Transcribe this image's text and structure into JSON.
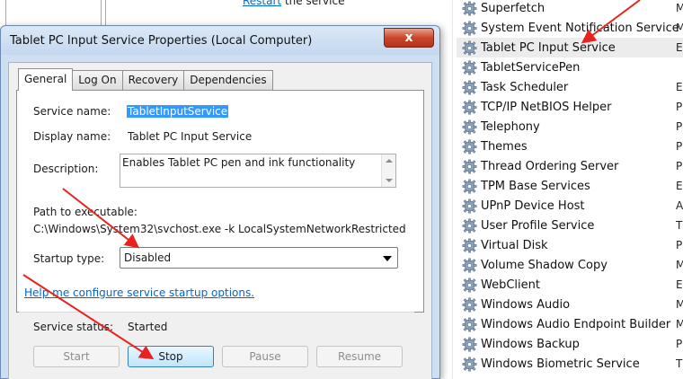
{
  "background": {
    "restart_link": "Restart",
    "restart_rest": " the service",
    "services": [
      {
        "name": "Superfetch",
        "col": "M",
        "selected": false
      },
      {
        "name": "System Event Notification Service",
        "col": "M",
        "selected": false
      },
      {
        "name": "Tablet PC Input Service",
        "col": "E",
        "selected": true
      },
      {
        "name": "TabletServicePen",
        "col": "",
        "selected": false
      },
      {
        "name": "Task Scheduler",
        "col": "E",
        "selected": false
      },
      {
        "name": "TCP/IP NetBIOS Helper",
        "col": "P",
        "selected": false
      },
      {
        "name": "Telephony",
        "col": "P",
        "selected": false
      },
      {
        "name": "Themes",
        "col": "P",
        "selected": false
      },
      {
        "name": "Thread Ordering Server",
        "col": "P",
        "selected": false
      },
      {
        "name": "TPM Base Services",
        "col": "E",
        "selected": false
      },
      {
        "name": "UPnP Device Host",
        "col": "A",
        "selected": false
      },
      {
        "name": "User Profile Service",
        "col": "T",
        "selected": false
      },
      {
        "name": "Virtual Disk",
        "col": "P",
        "selected": false
      },
      {
        "name": "Volume Shadow Copy",
        "col": "M",
        "selected": false
      },
      {
        "name": "WebClient",
        "col": "E",
        "selected": false
      },
      {
        "name": "Windows Audio",
        "col": "M",
        "selected": false
      },
      {
        "name": "Windows Audio Endpoint Builder",
        "col": "M",
        "selected": false
      },
      {
        "name": "Windows Backup",
        "col": "P",
        "selected": false
      },
      {
        "name": "Windows Biometric Service",
        "col": "T",
        "selected": false
      }
    ]
  },
  "dialog": {
    "title": "Tablet PC Input Service Properties (Local Computer)",
    "close_label": "x",
    "tabs": [
      "General",
      "Log On",
      "Recovery",
      "Dependencies"
    ],
    "active_tab": "General",
    "general": {
      "service_name_label": "Service name:",
      "service_name_value": "TabletInputService",
      "display_name_label": "Display name:",
      "display_name_value": "Tablet PC Input Service",
      "description_label": "Description:",
      "description_value": "Enables Tablet PC pen and ink functionality",
      "path_label": "Path to executable:",
      "path_value": "C:\\Windows\\System32\\svchost.exe -k LocalSystemNetworkRestricted",
      "startup_type_label": "Startup type:",
      "startup_type_value": "Disabled",
      "help_link": "Help me configure service startup options.",
      "service_status_label": "Service status:",
      "service_status_value": "Started"
    },
    "buttons": {
      "start": "Start",
      "stop": "Stop",
      "pause": "Pause",
      "resume": "Resume"
    }
  },
  "colors": {
    "annotation_arrow": "#e8231f",
    "selection_highlight": "#3399ff",
    "link": "#0066cc"
  },
  "icons": {
    "service": "gear-icon"
  }
}
